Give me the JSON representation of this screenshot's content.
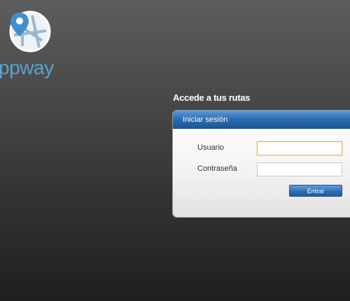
{
  "brand": {
    "name": "ppway",
    "logo_icon": "map-pin-icon",
    "accent_color": "#5aa3cf"
  },
  "login": {
    "heading": "Accede a tus rutas",
    "panel_title": "Iniciar sesión",
    "username_label": "Usuario",
    "username_value": "",
    "password_label": "Contraseña",
    "password_value": "",
    "submit_label": "Entrar",
    "header_color": "#2e6cb0"
  }
}
